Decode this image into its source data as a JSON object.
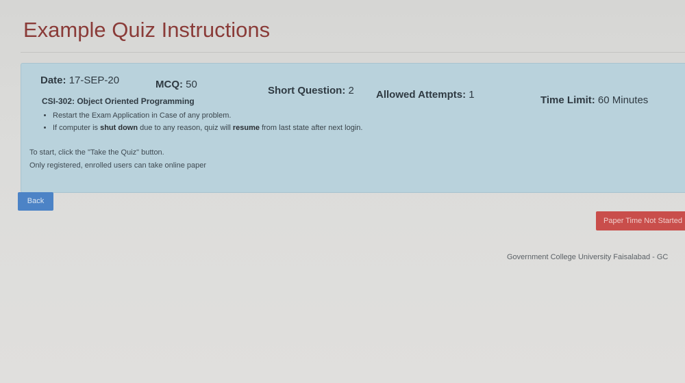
{
  "page": {
    "title": "Example Quiz Instructions"
  },
  "quiz": {
    "date_label": "Date:",
    "date_value": "17-SEP-20",
    "mcq_label": "MCQ:",
    "mcq_value": "50",
    "short_label": "Short Question:",
    "short_value": "2",
    "attempts_label": "Allowed Attempts:",
    "attempts_value": "1",
    "time_label": "Time Limit:",
    "time_value": "60 Minutes",
    "course": "CSI-302: Object Oriented Programming",
    "rule1": "Restart the Exam Application in Case of any problem.",
    "rule2_pre": "If computer is ",
    "rule2_bold1": "shut down",
    "rule2_mid": " due to any reason, quiz will ",
    "rule2_bold2": "resume",
    "rule2_post": " from last state after next login.",
    "note1": "To start, click the \"Take the Quiz\" button.",
    "note2": "Only registered, enrolled users can take online paper"
  },
  "actions": {
    "back_label": "Back",
    "status_label": "Paper Time Not Started"
  },
  "footer": {
    "text": "Government College University Faisalabad - GC"
  },
  "colors": {
    "title": "#8a3b38",
    "panel": "#b9d2dc",
    "back_button": "#4c83c6",
    "status_button": "#c94e4b"
  }
}
